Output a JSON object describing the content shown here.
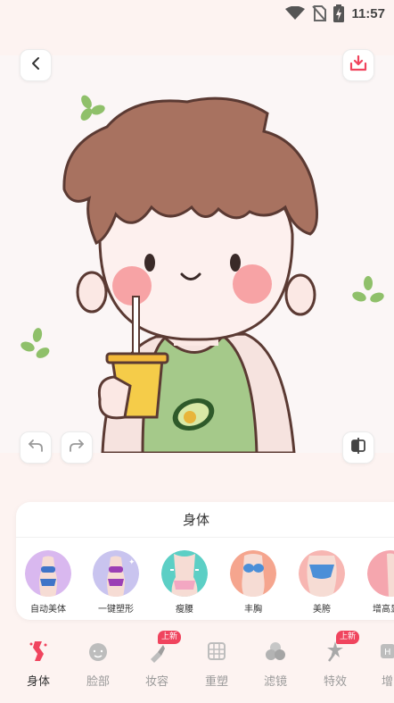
{
  "status_bar": {
    "time": "11:57",
    "icons": [
      "wifi-icon",
      "no-sim-icon",
      "battery-charging-icon"
    ]
  },
  "header": {
    "back_icon": "chevron-left-icon",
    "download_icon": "download-icon"
  },
  "canvas": {
    "undo_icon": "undo-icon",
    "redo_icon": "redo-icon",
    "compare_icon": "compare-icon"
  },
  "panel": {
    "title": "身体",
    "tools": [
      {
        "label": "自动美体",
        "color": "#d9b8ef"
      },
      {
        "label": "一键塑形",
        "color": "#c9c4ef"
      },
      {
        "label": "瘦腰",
        "color": "#5ccfc5"
      },
      {
        "label": "丰胸",
        "color": "#f5a58e"
      },
      {
        "label": "美胯",
        "color": "#f7b6b2"
      },
      {
        "label": "增高显瘦",
        "color": "#f5a6ae"
      }
    ]
  },
  "bottom_nav": {
    "items": [
      {
        "label": "身体",
        "icon": "body-icon",
        "active": true
      },
      {
        "label": "脸部",
        "icon": "face-icon"
      },
      {
        "label": "妆容",
        "icon": "lipstick-icon",
        "badge": "上新"
      },
      {
        "label": "重塑",
        "icon": "reshape-icon"
      },
      {
        "label": "滤镜",
        "icon": "filter-icon"
      },
      {
        "label": "特效",
        "icon": "effects-icon",
        "badge": "上新"
      },
      {
        "label": "增",
        "icon": "enhance-icon"
      }
    ]
  },
  "colors": {
    "accent": "#f0445e",
    "background": "#fdf3f1"
  }
}
